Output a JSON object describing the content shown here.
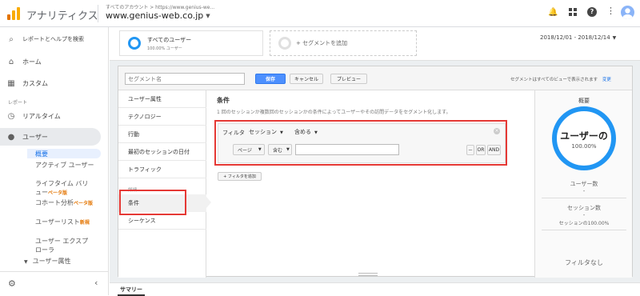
{
  "topbar": {
    "app_name": "アナリティクス",
    "account_path": "すべてのアカウント > https://www.genius-we...",
    "property": "www.genius-web.co.jp",
    "user_initial": "👤"
  },
  "sidebar": {
    "search_label": "レポートとヘルプを検索",
    "home": "ホーム",
    "custom": "カスタム",
    "reports_section": "レポート",
    "realtime": "リアルタイム",
    "users": "ユーザー",
    "sub_items": {
      "overview": "概要",
      "active_users": "アクティブ ユーザー",
      "lifetime_value": "ライフタイム バリュー",
      "lifetime_badge": "ベータ版",
      "cohort": "コホート分析",
      "cohort_badge": "ベータ版",
      "user_list": "ユーザーリスト",
      "user_list_badge": "新規",
      "user_explorer": "ユーザー エクスプローラ",
      "user_attributes": "ユーザー属性"
    }
  },
  "segments": {
    "all_users": "すべてのユーザー",
    "all_users_pct": "100.00% ユーザー",
    "add_segment": "+ セグメントを追加",
    "date_range": "2018/12/01 - 2018/12/14"
  },
  "editor": {
    "name_placeholder": "セグメント名",
    "save": "保存",
    "cancel": "キャンセル",
    "preview": "プレビュー",
    "visibility_note": "セグメントはすべてのビューで表示されます",
    "change_link": "変更",
    "categories": [
      "ユーザー属性",
      "テクノロジー",
      "行動",
      "最初のセッションの日付",
      "トラフィック"
    ],
    "advanced_label": "詳細",
    "advanced_items": [
      "条件",
      "シーケンス"
    ],
    "condition_title": "条件",
    "condition_desc": "1 回のセッションか複数回のセッションかの条件によってユーザーやその訪問データをセグメント化します。",
    "filter_label": "フィルタ",
    "filter_scope": "セッション",
    "filter_include": "含める",
    "dim_page": "ページ",
    "op_contains": "含む",
    "btn_minus": "－",
    "btn_or": "OR",
    "btn_and": "AND",
    "add_filter": "+ フィルタを追加"
  },
  "summary": {
    "title": "概要",
    "circle_text": "ユーザーの",
    "circle_pct": "100.00%",
    "users_label": "ユーザー数",
    "users_value": "-",
    "sessions_label": "セッション数",
    "sessions_value": "-",
    "sessions_pct": "セッションの100.00%",
    "no_filter": "フィルタなし"
  },
  "bottom_tab": "サマリー",
  "colors": {
    "accent_blue": "#1a73e8",
    "ring_blue": "#2196f3",
    "highlight_red": "#e53935",
    "logo_orange": "#f9ab00"
  }
}
